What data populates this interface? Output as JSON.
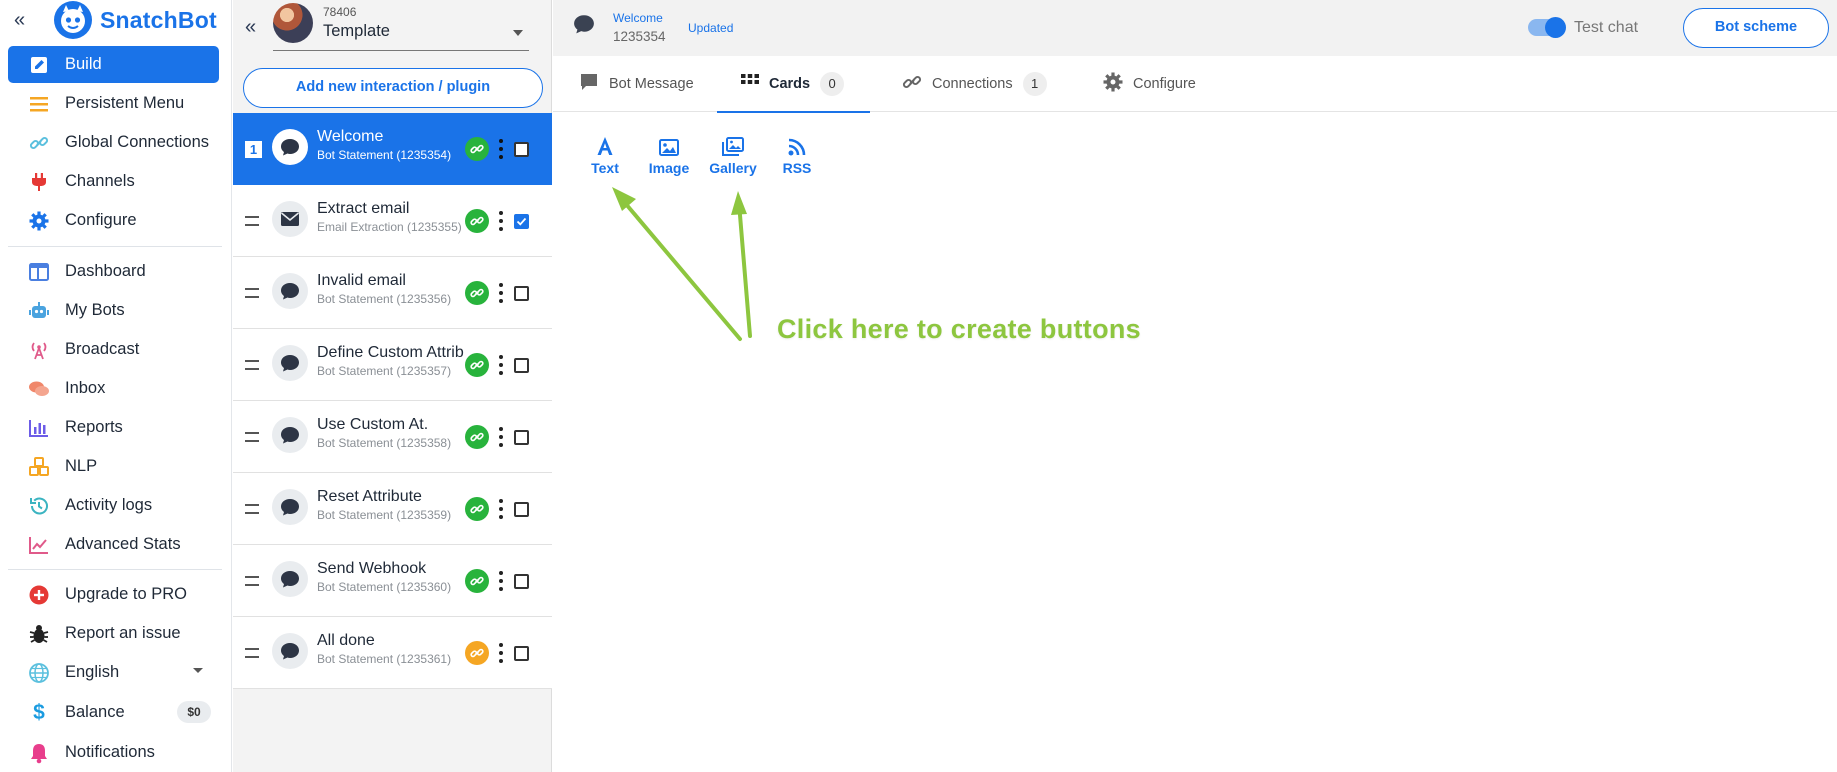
{
  "colors": {
    "accent": "#1a73e8",
    "link_ok": "#28b33c",
    "link_warn": "#f5a623",
    "annotation": "#8dc63f"
  },
  "sidebar": {
    "brand": "SnatchBot",
    "collapse_icon": "double-chevron-left-icon",
    "items": [
      {
        "label": "Build",
        "icon": "edit-icon",
        "active": true
      },
      {
        "label": "Persistent Menu",
        "icon": "menu-lines-icon"
      },
      {
        "label": "Global Connections",
        "icon": "link-icon"
      },
      {
        "label": "Channels",
        "icon": "plug-icon"
      },
      {
        "label": "Configure",
        "icon": "gear-icon"
      },
      {
        "label": "Dashboard",
        "icon": "dashboard-icon"
      },
      {
        "label": "My Bots",
        "icon": "robot-icon"
      },
      {
        "label": "Broadcast",
        "icon": "broadcast-icon"
      },
      {
        "label": "Inbox",
        "icon": "chat-bubbles-icon"
      },
      {
        "label": "Reports",
        "icon": "bar-chart-icon"
      },
      {
        "label": "NLP",
        "icon": "cubes-icon"
      },
      {
        "label": "Activity logs",
        "icon": "history-icon"
      },
      {
        "label": "Advanced Stats",
        "icon": "line-chart-icon"
      },
      {
        "label": "Upgrade to PRO",
        "icon": "plus-circle-icon"
      },
      {
        "label": "Report an issue",
        "icon": "bug-icon"
      },
      {
        "label": "English",
        "icon": "globe-icon"
      },
      {
        "label": "Balance",
        "icon": "dollar-icon",
        "badge": "$0"
      },
      {
        "label": "Notifications",
        "icon": "bell-icon"
      }
    ]
  },
  "interactions": {
    "bot_id": "78406",
    "bot_name": "Template",
    "add_button": "Add new interaction / plugin",
    "items": [
      {
        "order": "1",
        "name": "Welcome",
        "sub": "Bot Statement (1235354)",
        "icon": "chat-bubble-icon",
        "active": true,
        "checked": false,
        "link": "ok"
      },
      {
        "name": "Extract email",
        "sub": "Email Extraction (1235355)",
        "icon": "envelope-icon",
        "checked": true,
        "link": "ok"
      },
      {
        "name": "Invalid email",
        "sub": "Bot Statement (1235356)",
        "icon": "chat-bubble-icon",
        "checked": false,
        "link": "ok"
      },
      {
        "name": "Define Custom Attrib",
        "sub": "Bot Statement (1235357)",
        "icon": "chat-bubble-icon",
        "checked": false,
        "link": "ok"
      },
      {
        "name": "Use Custom At.",
        "sub": "Bot Statement (1235358)",
        "icon": "chat-bubble-icon",
        "checked": false,
        "link": "ok"
      },
      {
        "name": "Reset Attribute",
        "sub": "Bot Statement (1235359)",
        "icon": "chat-bubble-icon",
        "checked": false,
        "link": "ok"
      },
      {
        "name": "Send Webhook",
        "sub": "Bot Statement (1235360)",
        "icon": "chat-bubble-icon",
        "checked": false,
        "link": "ok"
      },
      {
        "name": "All done",
        "sub": "Bot Statement (1235361)",
        "icon": "chat-bubble-icon",
        "checked": false,
        "link": "warn"
      }
    ]
  },
  "editor": {
    "title": "Welcome",
    "id": "1235354",
    "status": "Updated",
    "toggle_label": "Test chat",
    "toggle_on": true,
    "scheme_button": "Bot scheme",
    "tabs": [
      {
        "label": "Bot Message",
        "icon": "message-square-icon"
      },
      {
        "label": "Cards",
        "icon": "grid-icon",
        "count": "0",
        "active": true
      },
      {
        "label": "Connections",
        "icon": "link-icon",
        "count": "1"
      },
      {
        "label": "Configure",
        "icon": "gear-icon"
      }
    ],
    "card_types": [
      {
        "label": "Text",
        "icon": "font-a-icon"
      },
      {
        "label": "Image",
        "icon": "image-icon"
      },
      {
        "label": "Gallery",
        "icon": "gallery-icon"
      },
      {
        "label": "RSS",
        "icon": "rss-icon"
      }
    ],
    "annotation": "Click here to create buttons"
  }
}
